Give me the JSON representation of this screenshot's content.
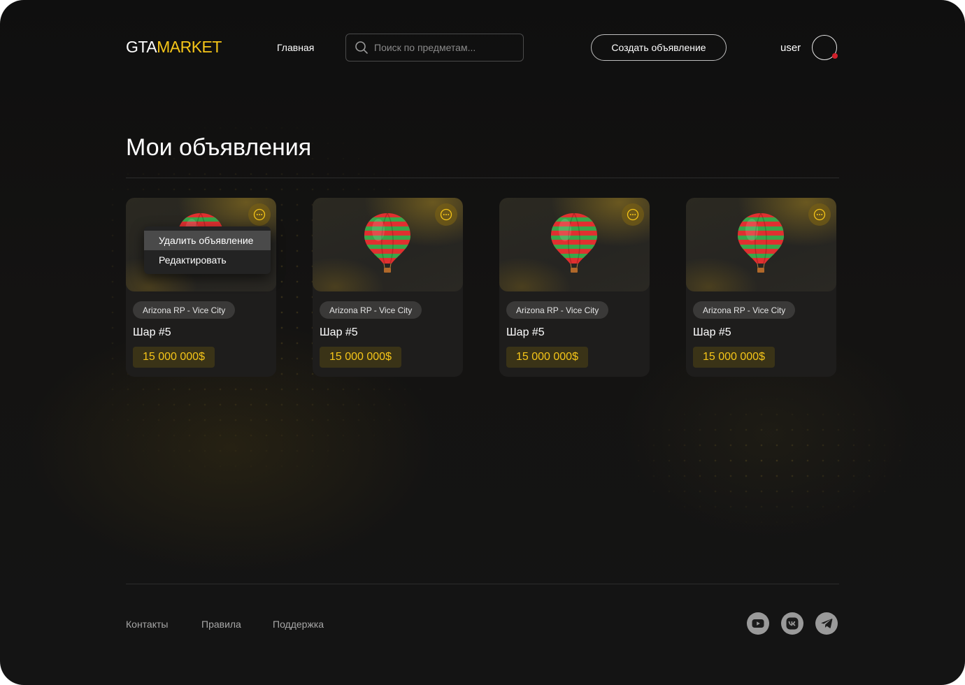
{
  "header": {
    "logo_part1": "GTA",
    "logo_part2": "MARKET",
    "nav_home": "Главная",
    "search_placeholder": "Поиск по предметам...",
    "create_button": "Создать объявление",
    "username": "user"
  },
  "page_title": "Мои объявления",
  "listings": [
    {
      "tag": "Arizona RP - Vice City",
      "name": "Шар #5",
      "price": "15 000 000$"
    },
    {
      "tag": "Arizona RP - Vice City",
      "name": "Шар #5",
      "price": "15 000 000$"
    },
    {
      "tag": "Arizona RP - Vice City",
      "name": "Шар #5",
      "price": "15 000 000$"
    },
    {
      "tag": "Arizona RP - Vice City",
      "name": "Шар #5",
      "price": "15 000 000$"
    }
  ],
  "context_menu": {
    "items": [
      "Удалить объявление",
      "Редактировать"
    ]
  },
  "footer": {
    "links": [
      "Контакты",
      "Правила",
      "Поддержка"
    ],
    "social_icons": [
      "youtube-icon",
      "vk-icon",
      "telegram-icon"
    ]
  },
  "colors": {
    "accent": "#f5c518",
    "background": "#121212",
    "card": "#1e1d1c",
    "notification": "#d0202a"
  }
}
